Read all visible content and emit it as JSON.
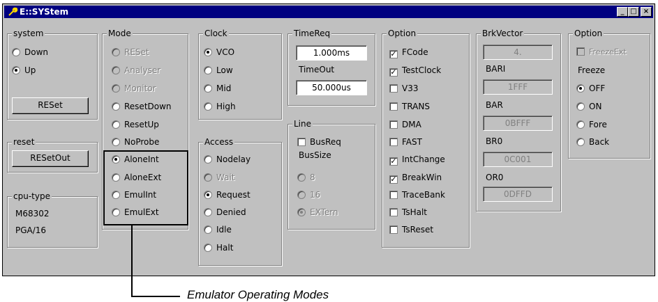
{
  "window": {
    "title": "E::SYStem",
    "min_label": "_",
    "max_label": "□",
    "close_label": "×"
  },
  "system": {
    "label": "system",
    "down": "Down",
    "up": "Up",
    "reset_button": "RESet"
  },
  "reset": {
    "label": "reset",
    "button": "RESetOut"
  },
  "cpu": {
    "label": "cpu-type",
    "model": "M68302",
    "package": "PGA/16"
  },
  "mode": {
    "label": "Mode",
    "items": [
      "RESet",
      "Analyser",
      "Monitor",
      "ResetDown",
      "ResetUp",
      "NoProbe",
      "AloneInt",
      "AloneExt",
      "EmulInt",
      "EmulExt"
    ]
  },
  "clock": {
    "label": "Clock",
    "items": [
      "VCO",
      "Low",
      "Mid",
      "High"
    ]
  },
  "access": {
    "label": "Access",
    "items": [
      "Nodelay",
      "Wait",
      "Request",
      "Denied",
      "Idle",
      "Halt"
    ]
  },
  "timereq": {
    "label": "TimeReq",
    "value": "1.000ms"
  },
  "timeout": {
    "label": "TimeOut",
    "value": "50.000us"
  },
  "line": {
    "label": "Line",
    "busreq": "BusReq"
  },
  "bussize": {
    "label": "BusSize",
    "items": [
      "8",
      "16",
      "EXTern"
    ]
  },
  "option": {
    "label": "Option",
    "items": [
      "FCode",
      "TestClock",
      "V33",
      "TRANS",
      "DMA",
      "FAST",
      "IntChange",
      "BreakWin",
      "TraceBank",
      "TsHalt",
      "TsReset"
    ],
    "check_mark": "✓"
  },
  "brk": {
    "label": "BrkVector",
    "value": "4."
  },
  "bari": {
    "label": "BARI",
    "value": "1FFF"
  },
  "bar": {
    "label": "BAR",
    "value": "0BFFF"
  },
  "br0": {
    "label": "BR0",
    "value": "0C001"
  },
  "or0": {
    "label": "OR0",
    "value": "0DFFD"
  },
  "option2": {
    "label": "Option",
    "freezeext": "FreezeExt"
  },
  "freeze": {
    "label": "Freeze",
    "items": [
      "OFF",
      "ON",
      "Fore",
      "Back"
    ]
  },
  "callout": "Emulator Operating Modes"
}
